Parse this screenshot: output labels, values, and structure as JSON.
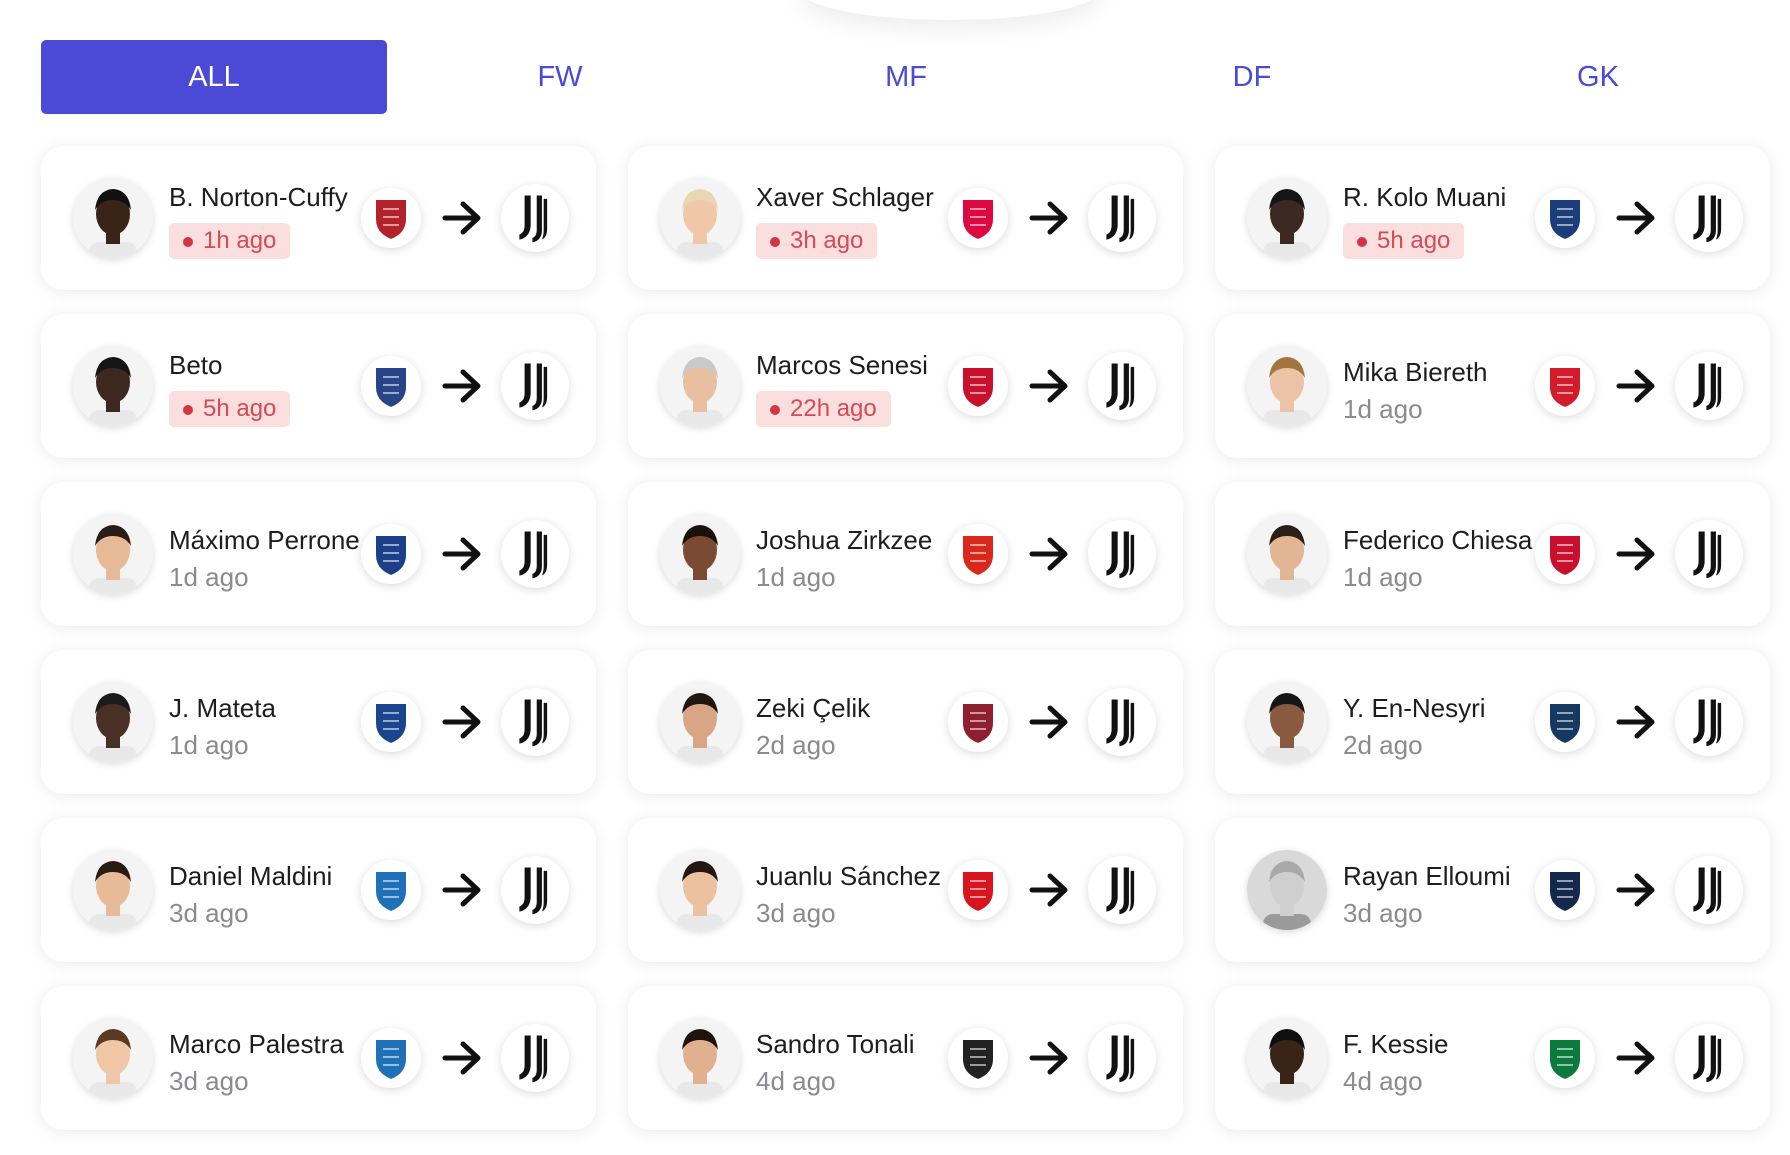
{
  "tabs": [
    {
      "label": "ALL",
      "active": true
    },
    {
      "label": "FW",
      "active": false
    },
    {
      "label": "MF",
      "active": false
    },
    {
      "label": "DF",
      "active": false
    },
    {
      "label": "GK",
      "active": false
    }
  ],
  "colors": {
    "accent": "#4a4ad6",
    "badge_bg": "#fbdede",
    "badge_text": "#d34b56",
    "muted": "#8a8a8f"
  },
  "transfers": [
    {
      "name": "B. Norton-Cuffy",
      "time": "1h ago",
      "recent": true,
      "from_club": "genoa-crest",
      "from_color": "#b3222b",
      "to_club": "juventus-crest",
      "skin": "#3a2418",
      "hair": "#111111"
    },
    {
      "name": "Xaver Schlager",
      "time": "3h ago",
      "recent": true,
      "from_club": "rb-leipzig-crest",
      "from_color": "#dd0741",
      "to_club": "juventus-crest",
      "skin": "#f0c7a8",
      "hair": "#e8d7b5"
    },
    {
      "name": "R. Kolo Muani",
      "time": "5h ago",
      "recent": true,
      "from_club": "psg-crest",
      "from_color": "#1b3d7a",
      "to_club": "juventus-crest",
      "skin": "#3b2820",
      "hair": "#151515"
    },
    {
      "name": "Beto",
      "time": "5h ago",
      "recent": true,
      "from_club": "everton-crest",
      "from_color": "#274488",
      "to_club": "juventus-crest",
      "skin": "#3c281e",
      "hair": "#151515"
    },
    {
      "name": "Marcos Senesi",
      "time": "22h ago",
      "recent": true,
      "from_club": "bournemouth-crest",
      "from_color": "#c8102e",
      "to_club": "juventus-crest",
      "skin": "#e8bfa0",
      "hair": "#c9c9c9"
    },
    {
      "name": "Mika Biereth",
      "time": "1d ago",
      "recent": false,
      "from_club": "monaco-crest",
      "from_color": "#d31b2b",
      "to_club": "juventus-crest",
      "skin": "#ecc3a4",
      "hair": "#a3743e"
    },
    {
      "name": "Máximo Perrone",
      "time": "1d ago",
      "recent": false,
      "from_club": "como-crest",
      "from_color": "#1c3f8a",
      "to_club": "juventus-crest",
      "skin": "#e6b997",
      "hair": "#2a1d15"
    },
    {
      "name": "Joshua Zirkzee",
      "time": "1d ago",
      "recent": false,
      "from_club": "man-united-crest",
      "from_color": "#da291c",
      "to_club": "juventus-crest",
      "skin": "#7a4a33",
      "hair": "#1a1208"
    },
    {
      "name": "Federico Chiesa",
      "time": "1d ago",
      "recent": false,
      "from_club": "liverpool-crest",
      "from_color": "#c8102e",
      "to_club": "juventus-crest",
      "skin": "#e2b595",
      "hair": "#2b1e16"
    },
    {
      "name": "J. Mateta",
      "time": "1d ago",
      "recent": false,
      "from_club": "crystal-palace-crest",
      "from_color": "#1b458f",
      "to_club": "juventus-crest",
      "skin": "#4a3024",
      "hair": "#1b1b1b"
    },
    {
      "name": "Zeki Çelik",
      "time": "2d ago",
      "recent": false,
      "from_club": "roma-crest",
      "from_color": "#8e1f2f",
      "to_club": "juventus-crest",
      "skin": "#d8a585",
      "hair": "#1f1712"
    },
    {
      "name": "Y. En-Nesyri",
      "time": "2d ago",
      "recent": false,
      "from_club": "fenerbahce-crest",
      "from_color": "#163962",
      "to_club": "juventus-crest",
      "skin": "#8a5a3e",
      "hair": "#161616"
    },
    {
      "name": "Daniel Maldini",
      "time": "3d ago",
      "recent": false,
      "from_club": "atalanta-crest",
      "from_color": "#1e71b8",
      "to_club": "juventus-crest",
      "skin": "#e8bb98",
      "hair": "#2a1c12"
    },
    {
      "name": "Juanlu Sánchez",
      "time": "3d ago",
      "recent": false,
      "from_club": "sevilla-crest",
      "from_color": "#d8141e",
      "to_club": "juventus-crest",
      "skin": "#ebc1a0",
      "hair": "#231810"
    },
    {
      "name": "Rayan Elloumi",
      "time": "3d ago",
      "recent": false,
      "from_club": "vancouver-crest",
      "from_color": "#12284c",
      "to_club": "juventus-crest",
      "skin": "#cfcfcf",
      "hair": "#a8a8a8"
    },
    {
      "name": "Marco Palestra",
      "time": "3d ago",
      "recent": false,
      "from_club": "atalanta-crest",
      "from_color": "#1e71b8",
      "to_club": "juventus-crest",
      "skin": "#efc6a6",
      "hair": "#5a3a22"
    },
    {
      "name": "Sandro Tonali",
      "time": "4d ago",
      "recent": false,
      "from_club": "newcastle-crest",
      "from_color": "#222222",
      "to_club": "juventus-crest",
      "skin": "#e0b08f",
      "hair": "#1e140c"
    },
    {
      "name": "F. Kessie",
      "time": "4d ago",
      "recent": false,
      "from_club": "al-ahli-crest",
      "from_color": "#0c7a3c",
      "to_club": "juventus-crest",
      "skin": "#3a2418",
      "hair": "#0f0f0f"
    }
  ]
}
